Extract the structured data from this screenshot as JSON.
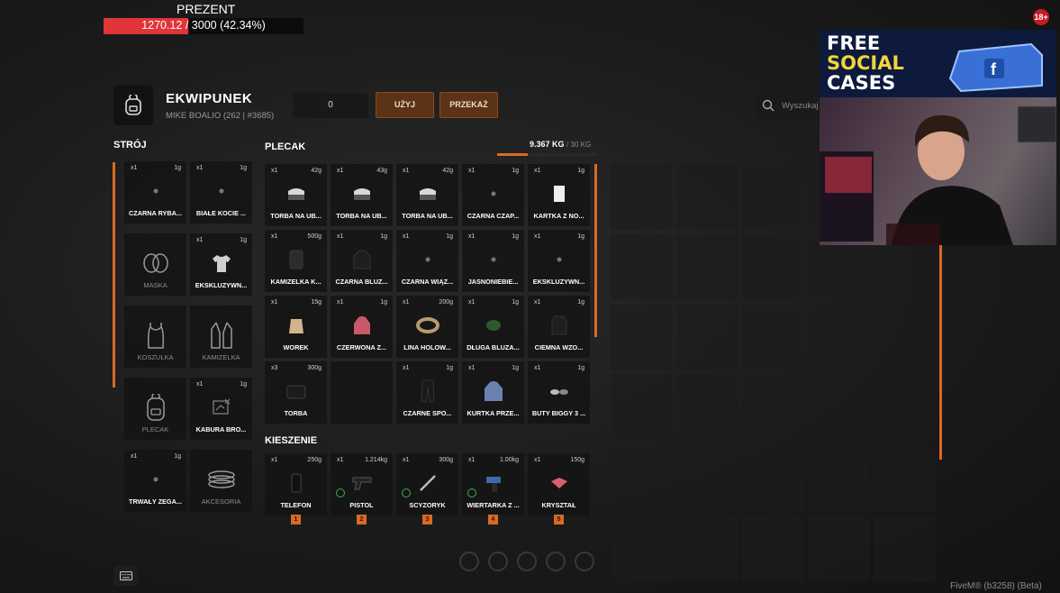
{
  "progress": {
    "title": "PREZENT",
    "text": "1270.12 / 3000 (42.34%)",
    "fraction": 0.4234
  },
  "age_badge": "18+",
  "inventory": {
    "title": "EKWIPUNEK",
    "player": "MIKE BOALIO (262 | #3685)",
    "quantity": "0",
    "use_label": "UŻYJ",
    "give_label": "PRZEKAŻ",
    "search_placeholder": "Wyszukaj"
  },
  "outfit": {
    "title": "STRÓJ",
    "slots": [
      {
        "count": "x1",
        "weight": "1g",
        "name": "CZARNA RYBA...",
        "icon": "fish-icon"
      },
      {
        "count": "x1",
        "weight": "1g",
        "name": "BIAŁE KOCIE ...",
        "icon": "ears-icon"
      },
      {
        "name": "MASKA",
        "icon": "mask-icon",
        "category": true
      },
      {
        "count": "x1",
        "weight": "1g",
        "name": "EKSKLUZYWN...",
        "icon": "shirt-icon"
      },
      {
        "name": "KOSZULKA",
        "icon": "tank-top-icon",
        "category": true
      },
      {
        "name": "KAMIZELKA",
        "icon": "vest-icon",
        "category": true
      },
      {
        "name": "PLECAK",
        "icon": "backpack-icon",
        "category": true
      },
      {
        "count": "x1",
        "weight": "1g",
        "name": "KABURA BRO...",
        "icon": "holster-icon"
      },
      {
        "count": "x1",
        "weight": "1g",
        "name": "TRWAŁY ZEGA...",
        "icon": "watch-icon"
      },
      {
        "name": "AKCESORIA",
        "icon": "accessories-icon",
        "category": true
      }
    ]
  },
  "backpack": {
    "title": "PLECAK",
    "weight_current": "9.367 KG",
    "weight_max": "/ 30 KG",
    "weight_fraction": 0.312,
    "slots": [
      {
        "count": "x1",
        "weight": "42g",
        "name": "TORBA NA UB...",
        "icon": "bag-icon"
      },
      {
        "count": "x1",
        "weight": "43g",
        "name": "TORBA NA UB...",
        "icon": "bag-icon"
      },
      {
        "count": "x1",
        "weight": "42g",
        "name": "TORBA NA UB...",
        "icon": "bag-icon"
      },
      {
        "count": "x1",
        "weight": "1g",
        "name": "CZARNA CZAP...",
        "icon": "cap-icon"
      },
      {
        "count": "x1",
        "weight": "1g",
        "name": "KARTKA Z NO...",
        "icon": "card-icon"
      },
      {
        "count": "x1",
        "weight": "500g",
        "name": "KAMIZELKA K...",
        "icon": "vest-item-icon"
      },
      {
        "count": "x1",
        "weight": "1g",
        "name": "CZARNA BLUZ...",
        "icon": "hoodie-icon"
      },
      {
        "count": "x1",
        "weight": "1g",
        "name": "CZARNA WIĄZ...",
        "icon": "tie-icon"
      },
      {
        "count": "x1",
        "weight": "1g",
        "name": "JASNONIEBIE...",
        "icon": "item-icon"
      },
      {
        "count": "x1",
        "weight": "1g",
        "name": "EKSKLUZYWN...",
        "icon": "jacket-icon"
      },
      {
        "count": "x1",
        "weight": "15g",
        "name": "WOREK",
        "icon": "sack-icon"
      },
      {
        "count": "x1",
        "weight": "1g",
        "name": "CZERWONA Z...",
        "icon": "red-hoodie-icon"
      },
      {
        "count": "x1",
        "weight": "200g",
        "name": "LINA HOLOW...",
        "icon": "rope-icon"
      },
      {
        "count": "x1",
        "weight": "1g",
        "name": "DŁUGA BLUZA...",
        "icon": "green-item-icon"
      },
      {
        "count": "x1",
        "weight": "1g",
        "name": "CIEMNA WZO...",
        "icon": "dark-jacket-icon"
      },
      {
        "count": "x3",
        "weight": "300g",
        "name": "TORBA",
        "icon": "small-bag-icon"
      },
      {
        "empty": true
      },
      {
        "count": "x1",
        "weight": "1g",
        "name": "CZARNE SPO...",
        "icon": "pants-icon"
      },
      {
        "count": "x1",
        "weight": "1g",
        "name": "KURTKA PRZE...",
        "icon": "blue-jacket-icon"
      },
      {
        "count": "x1",
        "weight": "1g",
        "name": "BUTY BIGGY 3 ...",
        "icon": "shoes-icon"
      }
    ]
  },
  "pockets": {
    "title": "KIESZENIE",
    "slots": [
      {
        "count": "x1",
        "weight": "250g",
        "name": "TELEFON",
        "icon": "phone-icon",
        "hotkey": "1"
      },
      {
        "count": "x1",
        "weight": "1.214kg",
        "name": "PISTOL",
        "icon": "pistol-icon",
        "hotkey": "2",
        "status": true
      },
      {
        "count": "x1",
        "weight": "300g",
        "name": "SCYZORYK",
        "icon": "knife-icon",
        "hotkey": "3",
        "status": true
      },
      {
        "count": "x1",
        "weight": "1.00kg",
        "name": "WIERTARKA Z ...",
        "icon": "drill-icon",
        "hotkey": "4",
        "status": true
      },
      {
        "count": "x1",
        "weight": "150g",
        "name": "KRYSZTAŁ",
        "icon": "crystal-icon",
        "hotkey": "5"
      }
    ]
  },
  "promo": {
    "line1": "FREE",
    "line2": "SOCIAL",
    "line3": "CASES"
  },
  "footer": "FiveM® (b3258) (Beta)",
  "colors": {
    "accent": "#d86a24",
    "progress": "#e0353a",
    "button": "#5c3316",
    "status": "#30b44a"
  }
}
